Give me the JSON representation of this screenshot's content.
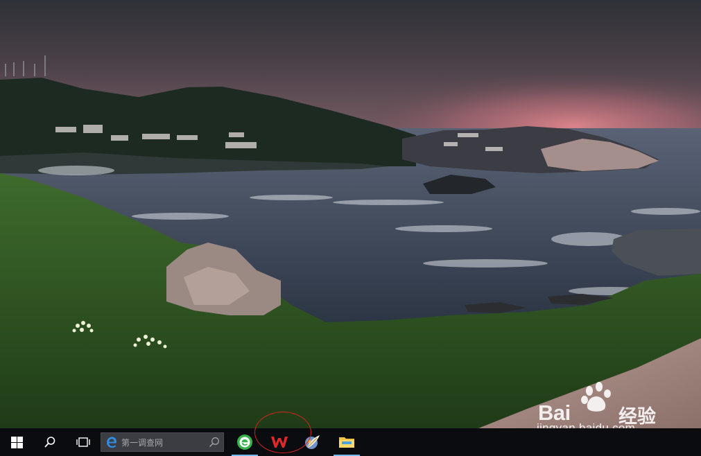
{
  "desktop": {
    "wallpaper": "coastal island landscape at dusk",
    "watermark": {
      "brand": "Bai",
      "brand_cn": "经验",
      "url": "jingyan.baidu.com"
    }
  },
  "taskbar": {
    "start_icon": "windows-logo-icon",
    "search_icon": "search-icon",
    "taskview_icon": "task-view-icon",
    "search_box": {
      "placeholder": "第一调查网",
      "browser_icon": "edge-e-icon",
      "mag_icon": "magnifier-icon"
    },
    "pinned_apps": [
      {
        "name": "green-browser",
        "icon": "green-e-icon",
        "running": true
      },
      {
        "name": "wps-office",
        "icon": "wps-w-icon",
        "running": true,
        "highlighted": true
      },
      {
        "name": "app-feather",
        "icon": "feather-app-icon",
        "running": false
      },
      {
        "name": "file-explorer",
        "icon": "folder-icon",
        "running": true
      }
    ]
  },
  "colors": {
    "taskbar": "#0a0c10",
    "running_indicator": "#76b9ed",
    "annotation": "#d6231f",
    "wps_red": "#e0282a"
  }
}
